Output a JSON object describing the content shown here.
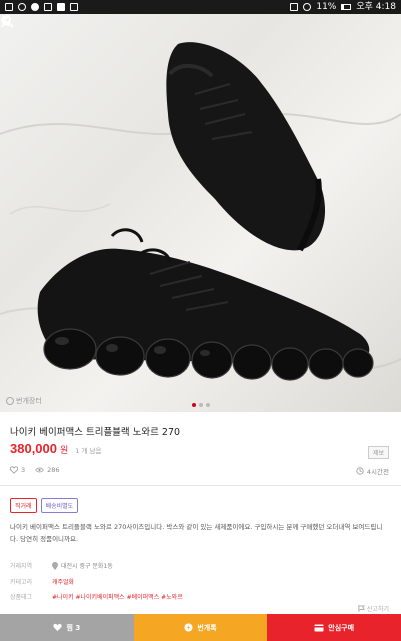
{
  "status_bar": {
    "battery": "11%",
    "time": "오후 4:18"
  },
  "product": {
    "title": "나이키 베이퍼맥스 트리플블랙 노와르 270",
    "price": "380,000",
    "currency": "원",
    "posted_ago": "1 개 남음",
    "share_label": "제보",
    "likes": "3",
    "views": "286",
    "posted_time": "4시간전"
  },
  "tags": [
    "직거래",
    "배송비별도"
  ],
  "description": "나이키 베이퍼맥스 트리플블랙 노와르 270사이즈입니다. 박스와 같이 있는 새제품이에요. 구입하시는 분께 구매했던 오더내역 보여드립니다. 당연히 정품이니까요.",
  "meta": {
    "location_label": "거래지역",
    "location_value": "대전시 중구 문화1동",
    "category_label": "카테고리",
    "category_value": "캐주얼화",
    "tags_label": "상품태그",
    "tags_value": "#나이키 #나이키베이퍼맥스 #베이퍼맥스 #노와르"
  },
  "report_label": "신고하기",
  "watermark": "번개장터",
  "bottom": {
    "like_label": "찜 3",
    "talk_label": "번개톡",
    "buy_label": "안심구매"
  },
  "colors": {
    "accent_red": "#e8232b",
    "orange": "#f5a623",
    "gray": "#a4a4a4"
  },
  "icons": [
    "back-arrow-icon",
    "search-icon",
    "profile-icon",
    "heart-icon",
    "eye-icon",
    "clock-icon",
    "location-pin-icon",
    "flag-icon",
    "chat-icon",
    "card-icon"
  ],
  "carousel": {
    "pages": 3,
    "current": 1
  }
}
